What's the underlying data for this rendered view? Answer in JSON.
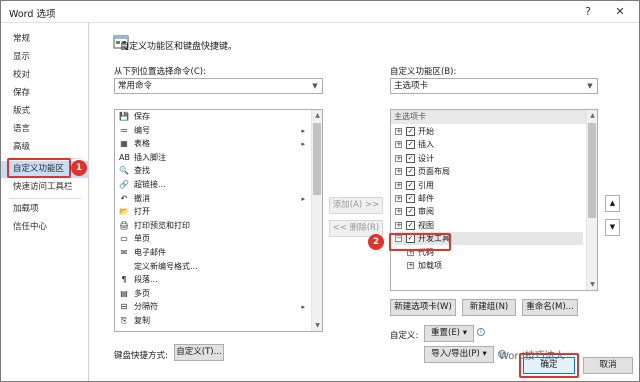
{
  "window": {
    "title": "Word 选项",
    "help": "?",
    "close": "✕"
  },
  "sidebar": {
    "items": [
      {
        "label": "常规"
      },
      {
        "label": "显示"
      },
      {
        "label": "校对"
      },
      {
        "label": "保存"
      },
      {
        "label": "版式"
      },
      {
        "label": "语言"
      },
      {
        "label": "高级"
      },
      {
        "label": "自定义功能区"
      },
      {
        "label": "快速访问工具栏"
      },
      {
        "label": "加载项"
      },
      {
        "label": "信任中心"
      }
    ],
    "active_index": 7
  },
  "callouts": {
    "one": "1",
    "two": "2"
  },
  "header": {
    "text": "自定义功能区和键盘快捷键。"
  },
  "left": {
    "label": "从下列位置选择命令(C):",
    "combo_value": "常用命令",
    "commands": [
      {
        "label": "保存",
        "icon": "save-icon",
        "glyph": "💾",
        "sub": ""
      },
      {
        "label": "编号",
        "icon": "numbering-icon",
        "glyph": "≔",
        "sub": "▸"
      },
      {
        "label": "表格",
        "icon": "table-icon",
        "glyph": "▦",
        "sub": "▸"
      },
      {
        "label": "插入脚注",
        "icon": "footnote-icon",
        "glyph": "AB",
        "sub": ""
      },
      {
        "label": "查找",
        "icon": "find-icon",
        "glyph": "🔍",
        "sub": ""
      },
      {
        "label": "超链接...",
        "icon": "hyperlink-icon",
        "glyph": "🔗",
        "sub": ""
      },
      {
        "label": "撤消",
        "icon": "undo-icon",
        "glyph": "↶",
        "sub": "▸"
      },
      {
        "label": "打开",
        "icon": "open-icon",
        "glyph": "📂",
        "sub": ""
      },
      {
        "label": "打印预览和打印",
        "icon": "print-preview-icon",
        "glyph": "🖨",
        "sub": ""
      },
      {
        "label": "单页",
        "icon": "single-page-icon",
        "glyph": "▭",
        "sub": ""
      },
      {
        "label": "电子邮件",
        "icon": "email-icon",
        "glyph": "✉",
        "sub": ""
      },
      {
        "label": "定义新编号格式...",
        "icon": "blank-icon",
        "glyph": "",
        "sub": ""
      },
      {
        "label": "段落...",
        "icon": "paragraph-icon",
        "glyph": "¶",
        "sub": ""
      },
      {
        "label": "多页",
        "icon": "multi-page-icon",
        "glyph": "▤",
        "sub": ""
      },
      {
        "label": "分隔符",
        "icon": "separator-icon",
        "glyph": "⊟",
        "sub": "▸"
      },
      {
        "label": "复制",
        "icon": "copy-icon",
        "glyph": "⎘",
        "sub": ""
      }
    ]
  },
  "middle": {
    "add_label": "添加(A) >>",
    "remove_label": "<< 删除(R)"
  },
  "right": {
    "label": "自定义功能区(B):",
    "combo_value": "主选项卡",
    "tree_header": "主选项卡",
    "tree": [
      {
        "label": "开始",
        "expander": "+",
        "checked": true,
        "indent": 0
      },
      {
        "label": "插入",
        "expander": "+",
        "checked": true,
        "indent": 0
      },
      {
        "label": "设计",
        "expander": "+",
        "checked": true,
        "indent": 0
      },
      {
        "label": "页面布局",
        "expander": "+",
        "checked": true,
        "indent": 0
      },
      {
        "label": "引用",
        "expander": "+",
        "checked": true,
        "indent": 0
      },
      {
        "label": "邮件",
        "expander": "+",
        "checked": true,
        "indent": 0
      },
      {
        "label": "审阅",
        "expander": "+",
        "checked": true,
        "indent": 0
      },
      {
        "label": "视图",
        "expander": "+",
        "checked": true,
        "indent": 0
      },
      {
        "label": "开发工具",
        "expander": "−",
        "checked": true,
        "indent": 0
      },
      {
        "label": "代码",
        "expander": "+",
        "checked": false,
        "indent": 1
      },
      {
        "label": "加载项",
        "expander": "+",
        "checked": false,
        "indent": 1
      }
    ],
    "new_tab": "新建选项卡(W)",
    "new_group": "新建组(N)",
    "rename": "重命名(M)...",
    "customize_label": "自定义:",
    "reset": "重置(E) ▾",
    "import_export": "导入/导出(P) ▾"
  },
  "keyboard": {
    "label": "键盘快捷方式:",
    "customize": "自定义(T)..."
  },
  "footer": {
    "ok": "确定",
    "cancel": "取消"
  },
  "watermark": "Word技巧达人",
  "colors": {
    "accent_red": "#e0332b",
    "active_bg": "#c8ddf3"
  }
}
